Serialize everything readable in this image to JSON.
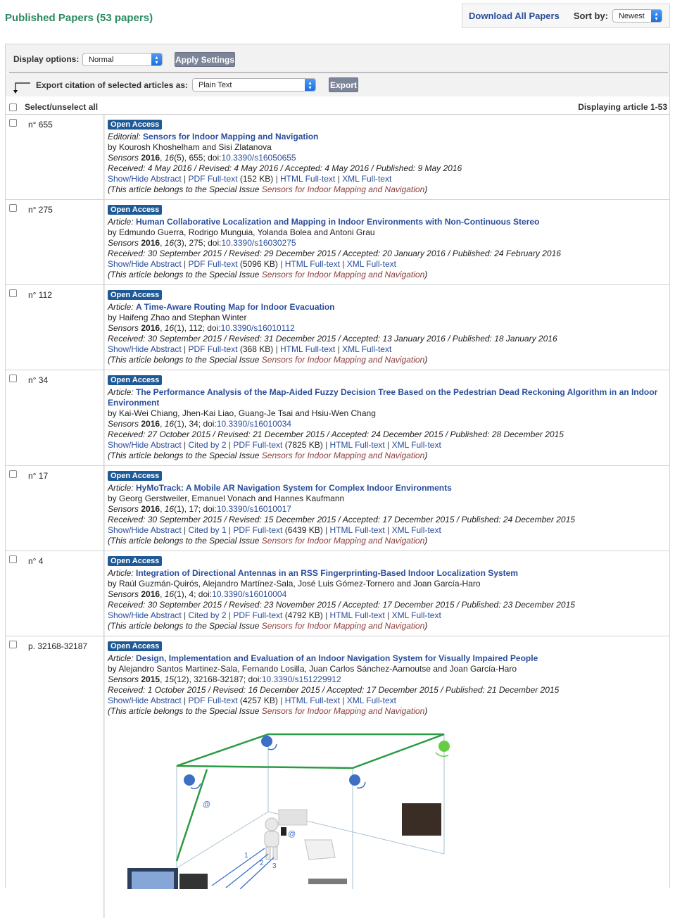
{
  "header": {
    "title": "Published Papers (53 papers)",
    "download_all": "Download All Papers",
    "sort_label": "Sort by:",
    "sort_value": "Newest"
  },
  "options": {
    "display_label": "Display options:",
    "display_value": "Normal",
    "apply_label": "Apply Settings",
    "export_label": "Export citation of selected articles as:",
    "export_format": "Plain Text",
    "export_button": "Export"
  },
  "list": {
    "select_all": "Select/unselect all",
    "displaying": "Displaying article 1-53"
  },
  "common": {
    "open_access": "Open Access",
    "show_hide": "Show/Hide Abstract",
    "pdf": "PDF Full-text",
    "html": "HTML Full-text",
    "xml": "XML Full-text",
    "belongs_prefix": "(This article belongs to the Special Issue ",
    "belongs_suffix": ")",
    "special_issue": "Sensors for Indoor Mapping and Navigation"
  },
  "articles": [
    {
      "num": "n° 655",
      "type": "Editorial:",
      "title": "Sensors for Indoor Mapping and Navigation",
      "authors": "by Kourosh Khoshelham and Sisi Zlatanova",
      "journal": "Sensors",
      "year": "2016",
      "vol": "16",
      "issue_pages": "(5), 655; doi:",
      "doi": "10.3390/s16050655",
      "dates": "Received: 4 May 2016 / Revised: 4 May 2016 / Accepted: 4 May 2016 / Published: 9 May 2016",
      "cited": "",
      "pdf_size": "(152 KB)"
    },
    {
      "num": "n° 275",
      "type": "Article:",
      "title": "Human Collaborative Localization and Mapping in Indoor Environments with Non-Continuous Stereo",
      "authors": "by Edmundo Guerra, Rodrigo Munguia, Yolanda Bolea and Antoni Grau",
      "journal": "Sensors",
      "year": "2016",
      "vol": "16",
      "issue_pages": "(3), 275; doi:",
      "doi": "10.3390/s16030275",
      "dates": "Received: 30 September 2015 / Revised: 29 December 2015 / Accepted: 20 January 2016 / Published: 24 February 2016",
      "cited": "",
      "pdf_size": "(5096 KB)"
    },
    {
      "num": "n° 112",
      "type": "Article:",
      "title": "A Time-Aware Routing Map for Indoor Evacuation",
      "authors": "by Haifeng Zhao and Stephan Winter",
      "journal": "Sensors",
      "year": "2016",
      "vol": "16",
      "issue_pages": "(1), 112; doi:",
      "doi": "10.3390/s16010112",
      "dates": "Received: 30 September 2015 / Revised: 31 December 2015 / Accepted: 13 January 2016 / Published: 18 January 2016",
      "cited": "",
      "pdf_size": "(368 KB)"
    },
    {
      "num": "n° 34",
      "type": "Article:",
      "title": "The Performance Analysis of the Map-Aided Fuzzy Decision Tree Based on the Pedestrian Dead Reckoning Algorithm in an Indoor Environment",
      "authors": "by Kai-Wei Chiang, Jhen-Kai Liao, Guang-Je Tsai and Hsiu-Wen Chang",
      "journal": "Sensors",
      "year": "2016",
      "vol": "16",
      "issue_pages": "(1), 34; doi:",
      "doi": "10.3390/s16010034",
      "dates": "Received: 27 October 2015 / Revised: 21 December 2015 / Accepted: 24 December 2015 / Published: 28 December 2015",
      "cited": "Cited by 2",
      "pdf_size": "(7825 KB)"
    },
    {
      "num": "n° 17",
      "type": "Article:",
      "title": "HyMoTrack: A Mobile AR Navigation System for Complex Indoor Environments",
      "authors": "by Georg Gerstweiler, Emanuel Vonach and Hannes Kaufmann",
      "journal": "Sensors",
      "year": "2016",
      "vol": "16",
      "issue_pages": "(1), 17; doi:",
      "doi": "10.3390/s16010017",
      "dates": "Received: 30 September 2015 / Revised: 15 December 2015 / Accepted: 17 December 2015 / Published: 24 December 2015",
      "cited": "Cited by 1",
      "pdf_size": "(6439 KB)"
    },
    {
      "num": "n° 4",
      "type": "Article:",
      "title": "Integration of Directional Antennas in an RSS Fingerprinting-Based Indoor Localization System",
      "authors": "by Raúl Guzmán-Quirós, Alejandro Martínez-Sala, José Luis Gómez-Tornero and Joan García-Haro",
      "journal": "Sensors",
      "year": "2016",
      "vol": "16",
      "issue_pages": "(1), 4; doi:",
      "doi": "10.3390/s16010004",
      "dates": "Received: 30 September 2015 / Revised: 23 November 2015 / Accepted: 17 December 2015 / Published: 23 December 2015",
      "cited": "Cited by 2",
      "pdf_size": "(4792 KB)"
    },
    {
      "num": "p. 32168-32187",
      "type": "Article:",
      "title": "Design, Implementation and Evaluation of an Indoor Navigation System for Visually Impaired People",
      "authors": "by Alejandro Santos Martinez-Sala, Fernando Losilla, Juan Carlos Sánchez-Aarnoutse and Joan García-Haro",
      "journal": "Sensors",
      "year": "2015",
      "vol": "15",
      "issue_pages": "(12), 32168-32187; doi:",
      "doi": "10.3390/s151229912",
      "dates": "Received: 1 October 2015 / Revised: 16 December 2015 / Accepted: 17 December 2015 / Published: 21 December 2015",
      "cited": "",
      "pdf_size": "(4257 KB)"
    }
  ],
  "figure_labels": {
    "at1": "@",
    "at2": "@",
    "n1": "1",
    "n2": "2",
    "n3": "3"
  },
  "colors": {
    "title_green": "#2b8a62",
    "link_blue": "#2a4d9b",
    "oa_badge": "#1f5a96",
    "special_issue": "#8b3d3d",
    "button_grey": "#7d8598"
  }
}
